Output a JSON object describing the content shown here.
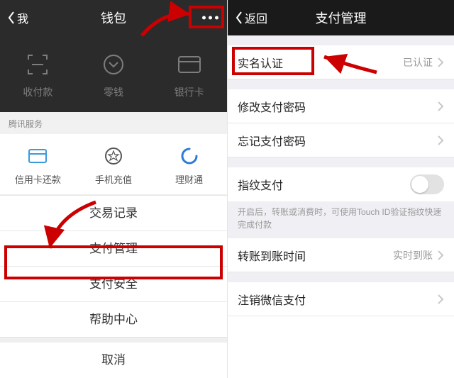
{
  "left": {
    "nav": {
      "back_label": "我",
      "title": "钱包"
    },
    "top_actions": [
      {
        "label": "收付款",
        "icon": "scan-icon"
      },
      {
        "label": "零钱",
        "icon": "coin-icon"
      },
      {
        "label": "银行卡",
        "icon": "card-icon"
      }
    ],
    "section_label": "腾讯服务",
    "services": [
      {
        "label": "信用卡还款",
        "icon": "card-service-icon"
      },
      {
        "label": "手机充值",
        "icon": "star-icon"
      },
      {
        "label": "理财通",
        "icon": "spinner-icon"
      }
    ],
    "sheet": {
      "items": [
        "交易记录",
        "支付管理",
        "支付安全",
        "帮助中心"
      ],
      "cancel": "取消"
    }
  },
  "right": {
    "nav": {
      "back_label": "返回",
      "title": "支付管理"
    },
    "rows": {
      "real_name": {
        "label": "实名认证",
        "value": "已认证"
      },
      "change_pwd": {
        "label": "修改支付密码"
      },
      "forgot_pwd": {
        "label": "忘记支付密码"
      },
      "fingerprint": {
        "label": "指纹支付",
        "hint": "开启后，转账或消费时，可使用Touch ID验证指纹快速完成付款"
      },
      "arrival": {
        "label": "转账到账时间",
        "value": "实时到账"
      },
      "deregister": {
        "label": "注销微信支付"
      }
    }
  }
}
